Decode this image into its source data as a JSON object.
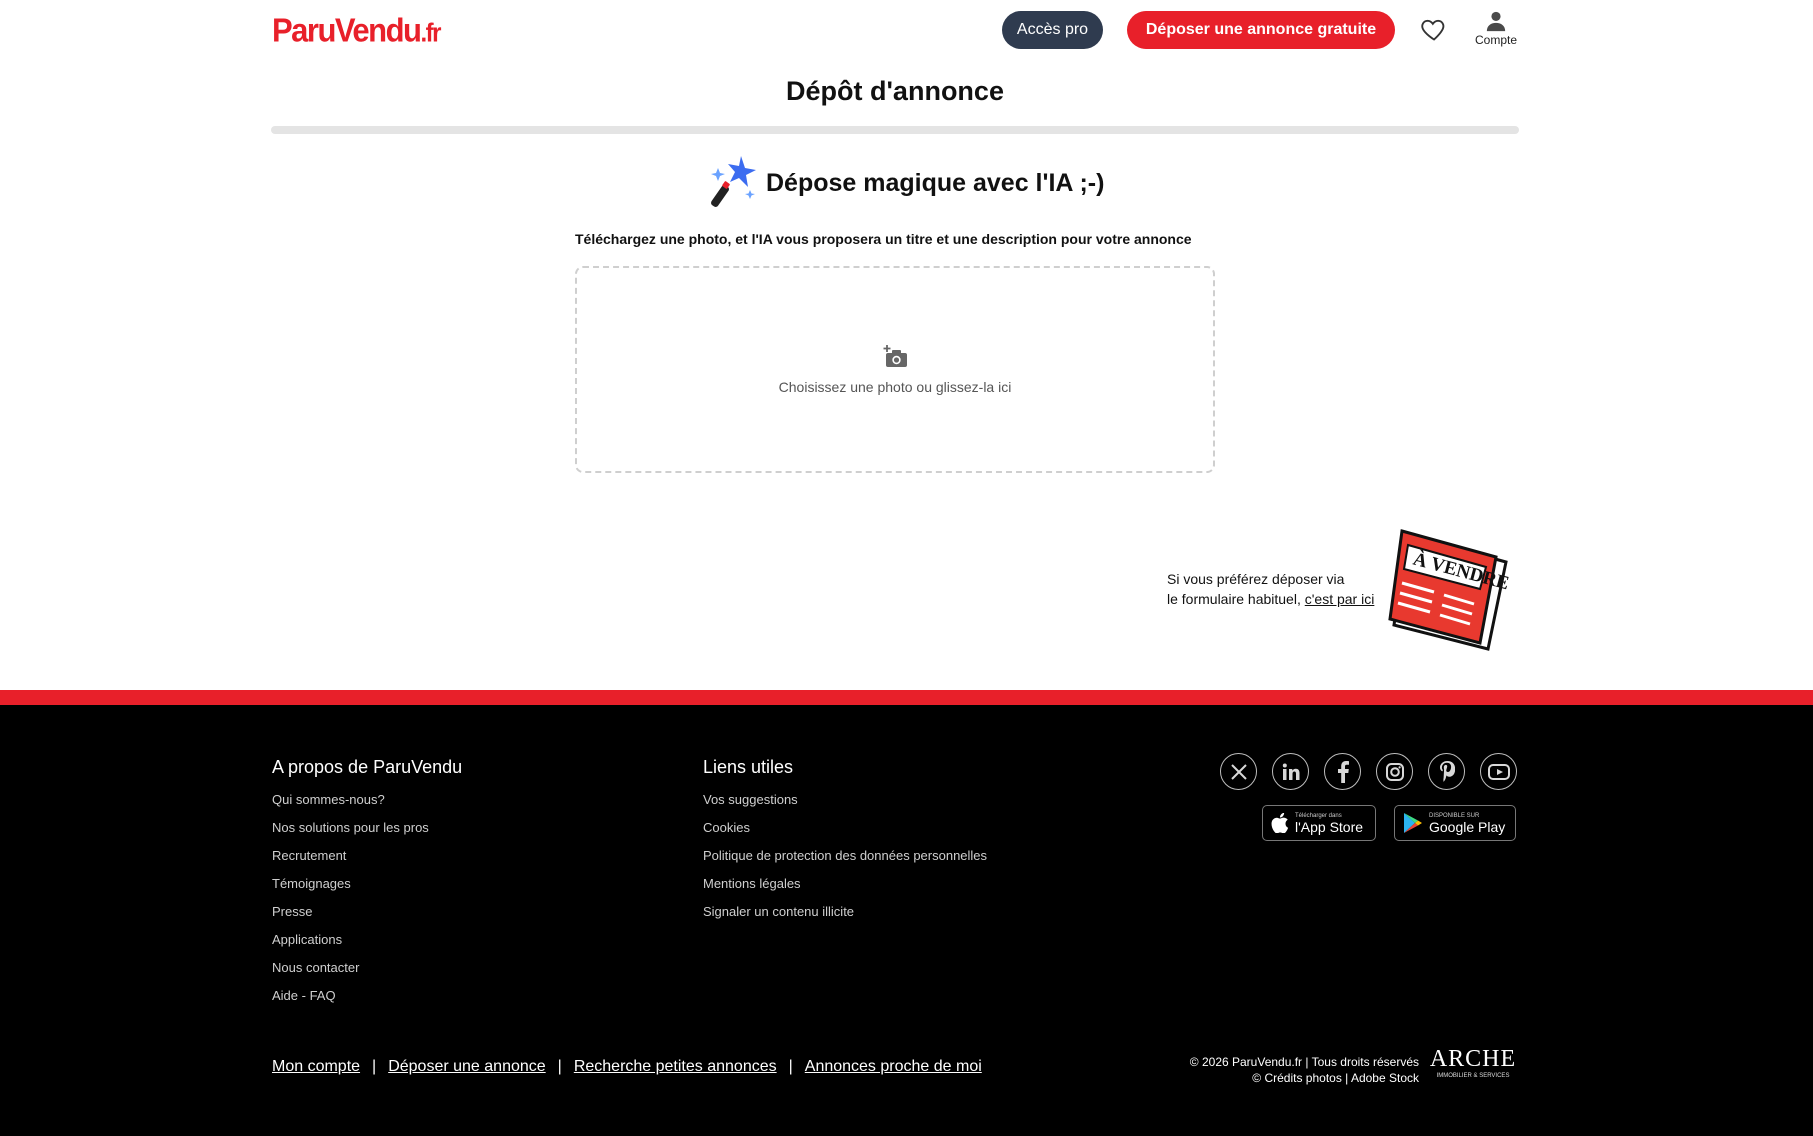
{
  "header": {
    "logo": {
      "part1": "Paru",
      "part2": "Vendu",
      "part3": ".fr"
    },
    "acces_pro": "Accès pro",
    "deposer": "Déposer une annonce gratuite",
    "account_label": "Compte"
  },
  "page": {
    "title": "Dépôt d'annonce",
    "magic_title": "Dépose magique avec l'IA ;-)",
    "subtitle": "Téléchargez une photo, et l'IA vous proposera un titre et une description pour votre annonce",
    "dropzone_text": "Choisissez une photo ou glissez-la ici",
    "alt_line1": "Si vous préférez déposer via",
    "alt_line2": "le formulaire habituel,",
    "alt_link": "c'est par ici",
    "newspaper_text": "À VENDRE"
  },
  "footer": {
    "about": {
      "title": "A propos de ParuVendu",
      "links": [
        "Qui sommes-nous?",
        "Nos solutions pour les pros",
        "Recrutement",
        "Témoignages",
        "Presse",
        "Applications",
        "Nous contacter",
        "Aide - FAQ"
      ]
    },
    "useful": {
      "title": "Liens utiles",
      "links": [
        "Vos suggestions",
        "Cookies",
        "Politique de protection des données personnelles",
        "Mentions légales",
        "Signaler un contenu illicite"
      ]
    },
    "social_icons": [
      "x-icon",
      "linkedin-icon",
      "facebook-icon",
      "instagram-icon",
      "pinterest-icon",
      "youtube-icon"
    ],
    "appstore": {
      "small": "Télécharger dans",
      "big": "l'App Store"
    },
    "googleplay": {
      "small": "DISPONIBLE SUR",
      "big": "Google Play"
    },
    "bottom_links": [
      "Mon compte",
      "Déposer une annonce",
      "Recherche petites annonces",
      "Annonces proche de moi"
    ],
    "separator": "|",
    "copyright1": "© 2026 ParuVendu.fr | Tous droits réservés",
    "copyright2": "© Crédits photos | Adobe Stock",
    "arche": {
      "name": "ARCHE",
      "tagline": "IMMOBILIER & SERVICES"
    }
  },
  "colors": {
    "brand_red": "#e8202a",
    "pro_button": "#2f3b4f",
    "footer_bg": "#000000"
  }
}
